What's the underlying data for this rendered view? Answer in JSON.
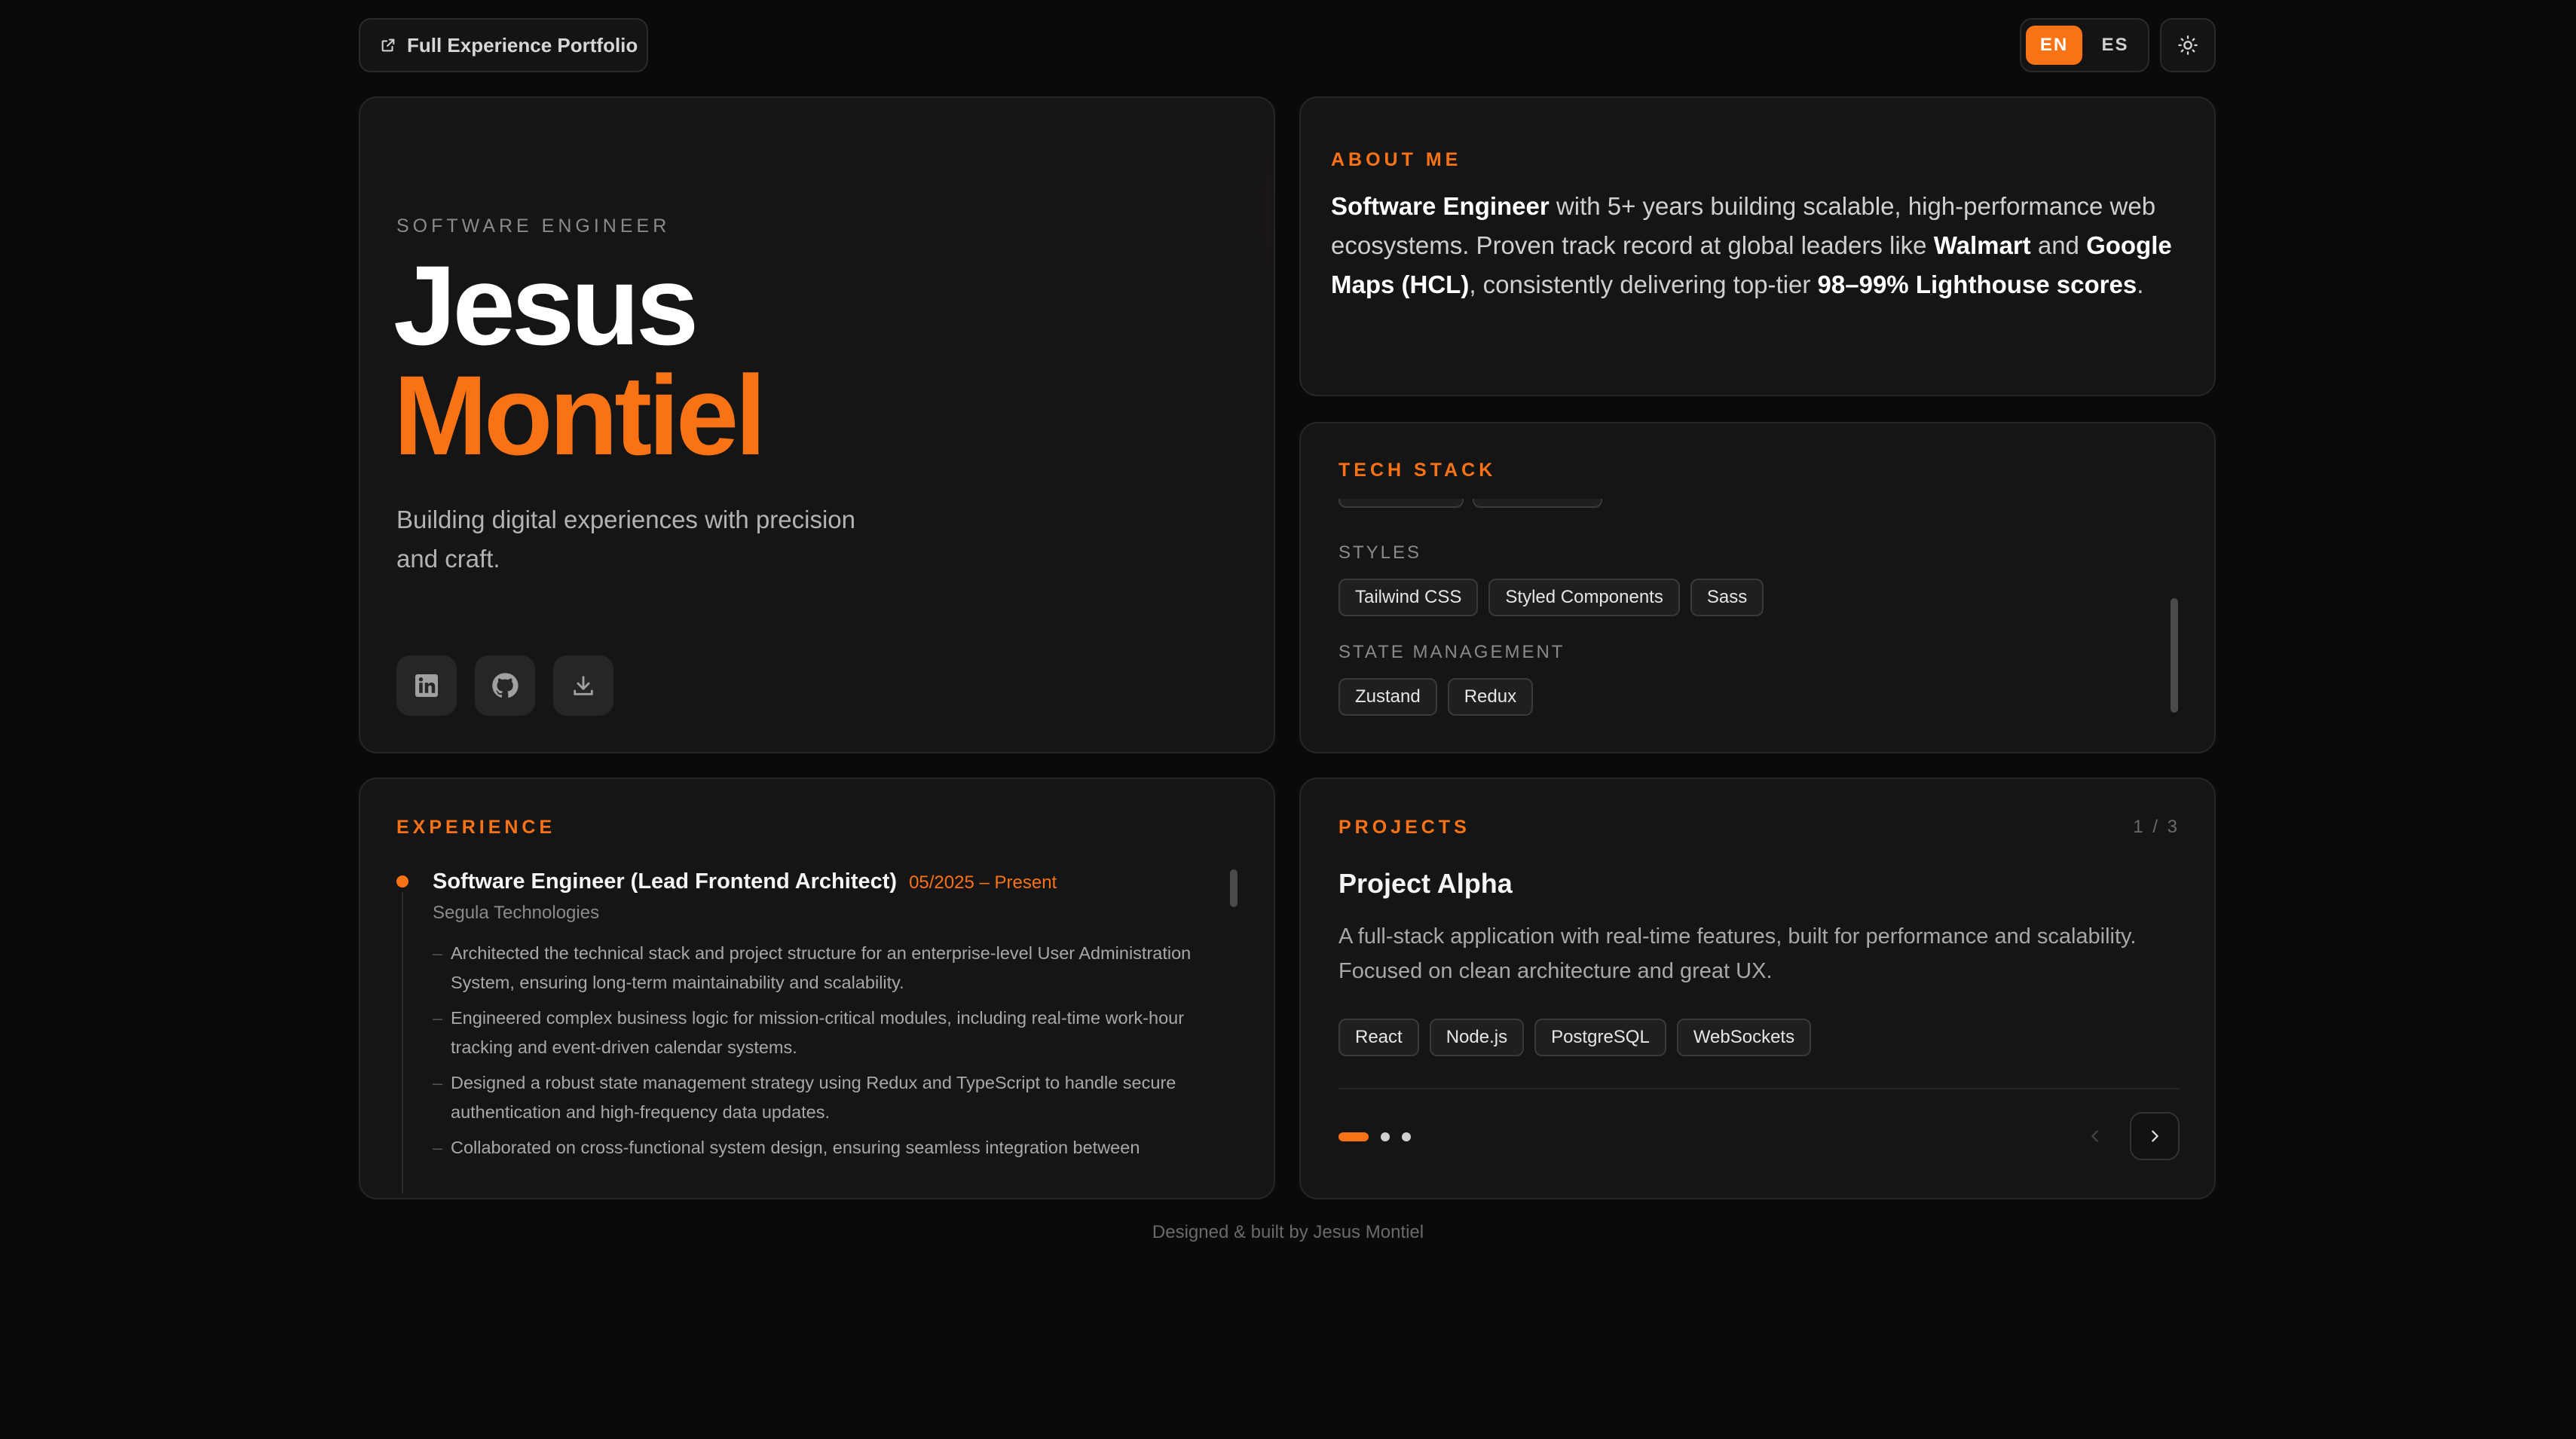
{
  "header": {
    "portfolio_link_label": "Full Experience Portfolio",
    "languages": [
      "EN",
      "ES"
    ],
    "active_language": "EN"
  },
  "hero": {
    "role": "SOFTWARE ENGINEER",
    "first_name": "Jesus",
    "last_name": "Montiel",
    "tagline_line1": "Building digital experiences with precision",
    "tagline_line2": "and craft.",
    "social_icons": [
      "linkedin-icon",
      "github-icon",
      "download-icon"
    ]
  },
  "about": {
    "label": "ABOUT ME",
    "segments": [
      {
        "text": "Software Engineer",
        "bold": true
      },
      {
        "text": " with 5+ years building scalable, high-performance web ecosystems. Proven track record at global leaders like ",
        "bold": false
      },
      {
        "text": "Walmart",
        "bold": true
      },
      {
        "text": " and ",
        "bold": false
      },
      {
        "text": "Google Maps (HCL)",
        "bold": true
      },
      {
        "text": ", consistently delivering top-tier ",
        "bold": false
      },
      {
        "text": "98–99% Lighthouse scores",
        "bold": true
      },
      {
        "text": ".",
        "bold": false
      }
    ]
  },
  "tech_stack": {
    "label": "TECH STACK",
    "groups": [
      {
        "name": "STYLES",
        "items": [
          "Tailwind CSS",
          "Styled Components",
          "Sass"
        ]
      },
      {
        "name": "STATE MANAGEMENT",
        "items": [
          "Zustand",
          "Redux"
        ]
      }
    ]
  },
  "experience": {
    "label": "EXPERIENCE",
    "title": "Software Engineer (Lead Frontend Architect)",
    "dates": "05/2025 – Present",
    "company": "Segula Technologies",
    "bullets": [
      "Architected the technical stack and project structure for an enterprise-level User Administration System, ensuring long-term maintainability and scalability.",
      "Engineered complex business logic for mission-critical modules, including real-time work-hour tracking and event-driven calendar systems.",
      "Designed a robust state management strategy using Redux and TypeScript to handle secure authentication and high-frequency data updates.",
      "Collaborated on cross-functional system design, ensuring seamless integration between"
    ]
  },
  "projects": {
    "label": "PROJECTS",
    "counter": "1 / 3",
    "title": "Project Alpha",
    "description": "A full-stack application with real-time features, built for performance and scalability. Focused on clean architecture and great UX.",
    "tags": [
      "React",
      "Node.js",
      "PostgreSQL",
      "WebSockets"
    ],
    "active_slide": 1,
    "total_slides": 3
  },
  "footer": {
    "credit": "Designed & built by Jesus Montiel"
  },
  "colors": {
    "accent": "#f97316",
    "background": "#0a0a0a",
    "card": "#151515"
  }
}
